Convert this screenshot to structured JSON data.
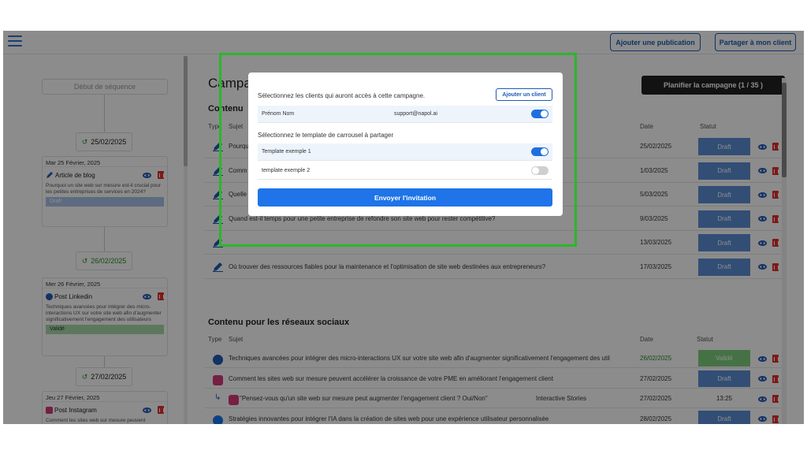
{
  "topbar": {
    "add_publication": "Ajouter une publication",
    "share_client": "Partager à mon client"
  },
  "sidebar": {
    "sequence_start": "Début de séquence",
    "dates": [
      "25/02/2025",
      "26/02/2025",
      "27/02/2025"
    ],
    "cards": [
      {
        "day": "Mar 25 Février, 2025",
        "type": "Article de blog",
        "icon": "pencil-icon",
        "desc": "Pourquoi un site web sur mesure est-il crucial pour les petites entreprises de services en 2024?",
        "status": "Draft"
      },
      {
        "day": "Mer 26 Février, 2025",
        "type": "Post Linkedin",
        "icon": "linkedin-icon",
        "desc": "Techniques avancées pour intégrer des micro-interactions UX sur votre site web afin d'augmenter significativement l'engagement des utilisateurs",
        "status": "Validé"
      },
      {
        "day": "Jeu 27 Février, 2025",
        "type": "Post Instagram",
        "icon": "instagram-icon",
        "desc": "Comment les sites web sur mesure peuvent accélérer la croissance de votre PME en améliorant l'engagement client",
        "status": ""
      }
    ]
  },
  "main": {
    "title": "Campa",
    "plan_button": "Planifier la campagne (1 / 35 )",
    "section1": "Contenu",
    "section2": "Contenu pour les réseaux sociaux",
    "col_type": "Type",
    "col_subject": "Sujet",
    "col_date": "Date",
    "col_status": "Statut",
    "blog_rows": [
      {
        "subject": "Pourqu",
        "date": "25/02/2025",
        "status": "Draft"
      },
      {
        "subject": "Comm",
        "date": "1/03/2025",
        "status": "Draft"
      },
      {
        "subject": "Quelle",
        "date": "5/03/2025",
        "status": "Draft"
      },
      {
        "subject": "Quand est-il temps pour une petite entreprise de refondre son site web pour rester compétitive?",
        "date": "9/03/2025",
        "status": "Draft"
      },
      {
        "subject": "",
        "date": "13/03/2025",
        "status": "Draft"
      },
      {
        "subject": "Où trouver des ressources fiables pour la maintenance et l'optimisation de site web destinées aux entrepreneurs?",
        "date": "17/03/2025",
        "status": "Draft"
      }
    ],
    "social_rows": [
      {
        "icon": "linkedin-icon",
        "subject": "Techniques avancées pour intégrer des micro-interactions UX sur votre site web afin d'augmenter significativement l'engagement des util",
        "date": "26/02/2025",
        "status": "Validé"
      },
      {
        "icon": "instagram-icon",
        "subject": "Comment les sites web sur mesure peuvent accélérer la croissance de votre PME en améliorant l'engagement client",
        "date": "27/02/2025",
        "status": "Draft"
      },
      {
        "icon": "instagram-icon",
        "subject": "\"Pensez-vous qu'un site web sur mesure peut augmenter l'engagement client ? Oui/Non\"",
        "extra": "Interactive Stories",
        "date": "27/02/2025",
        "status": "13:25"
      },
      {
        "icon": "facebook-icon",
        "subject": "Stratégies innovantes pour intégrer l'IA dans la création de sites web pour une expérience utilisateur personnalisée",
        "date": "28/02/2025",
        "status": "Draft"
      }
    ]
  },
  "modal": {
    "clients_label": "Sélectionnez les clients qui auront accès à cette campagne.",
    "add_client": "Ajouter un client",
    "client_name": "Prénom Nom",
    "client_email": "support@napol.ai",
    "client_enabled": true,
    "template_label": "Sélectionnez le template de carrousel à partager",
    "templates": [
      {
        "name": "Template exemple 1",
        "enabled": true
      },
      {
        "name": "template exemple 2",
        "enabled": false
      }
    ],
    "send_button": "Envoyer l'invitation"
  },
  "colors": {
    "accent": "#1f5bb5",
    "draft": "#5b8fd6",
    "valid": "#7fcf7f",
    "highlight": "#2bb62b"
  }
}
